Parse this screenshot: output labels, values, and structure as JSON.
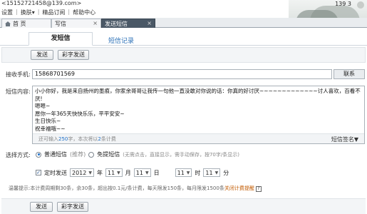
{
  "account": {
    "email": "<15152721458@139.com>"
  },
  "top_links": [
    "设置",
    "换肤",
    "精品订阅",
    "帮助中心"
  ],
  "top_right": {
    "id_text": "139",
    "num": "3"
  },
  "tabs": [
    {
      "label": "首 页"
    },
    {
      "label": "写信"
    },
    {
      "label": "发送短信"
    }
  ],
  "subtabs": {
    "active": "发短信",
    "record": "短信记录"
  },
  "toolbar": {
    "send": "发送",
    "color_send": "彩字发送"
  },
  "form": {
    "recipient_label": "接收手机:",
    "recipient_value": "15868701569",
    "contacts_button": "联系",
    "content_label": "短信内容:",
    "content_text": "小小你好，我是来自扬州的墨痕，你家余哥哥让我传一句他一直没敢对你说的话：你真的好讨厌~~~~~~~~~~~~~讨人喜欢，百看不厌!\n嗯嗯~\n愿你一年365天快快乐乐，平平安安~\n生日快乐~\n祝幸福哦~~",
    "remain_prefix": "还可输入",
    "remain_count": "250",
    "remain_mid": "字，本次将以",
    "remain_parts": "2",
    "remain_suffix": "条计费",
    "signature": "短信签名▼"
  },
  "send_mode": {
    "label": "选择方式:",
    "normal": "普通短信",
    "normal_note": "(推荐)",
    "free": "免提短信",
    "free_note": "(无需点击，直接显示，需手动保存，按70字/条显示)"
  },
  "schedule": {
    "label": "定时发送",
    "year": "2012",
    "year_unit": "年",
    "month": "11",
    "month_unit": "月",
    "day": "11",
    "day_unit": "日",
    "hour": "11",
    "hour_unit": "时",
    "minute": "11",
    "minute_unit": "分"
  },
  "tip": {
    "text": "温馨提示:本计费周期剩30条，余30条，超出按0.1元/条计费，每天限发150条，每月限发1500条",
    "link": "关闭计费提醒"
  },
  "bottom": {
    "send": "发送",
    "color_send": "彩字发送"
  }
}
